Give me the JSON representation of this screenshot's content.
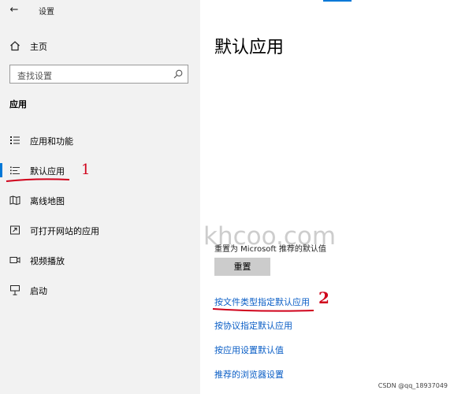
{
  "window": {
    "title": "设置",
    "back_icon": "arrow-left-icon"
  },
  "sidebar": {
    "home_label": "主页",
    "search_placeholder": "查找设置",
    "section_label": "应用",
    "items": [
      {
        "label": "应用和功能",
        "icon": "apps-list-icon"
      },
      {
        "label": "默认应用",
        "icon": "default-apps-icon",
        "selected": true
      },
      {
        "label": "离线地图",
        "icon": "map-icon"
      },
      {
        "label": "可打开网站的应用",
        "icon": "external-link-icon"
      },
      {
        "label": "视频播放",
        "icon": "video-icon"
      },
      {
        "label": "启动",
        "icon": "startup-icon"
      }
    ]
  },
  "main": {
    "title": "默认应用",
    "reset_text": "重置为 Microsoft 推荐的默认值",
    "reset_button": "重置",
    "links": [
      "按文件类型指定默认应用",
      "按协议指定默认应用",
      "按应用设置默认值",
      "推荐的浏览器设置"
    ]
  },
  "annotations": [
    "1",
    "2"
  ],
  "overlay": {
    "watermark": "khcoo.com",
    "credit": "CSDN @qq_18937049"
  },
  "colors": {
    "accent": "#0078d7",
    "link": "#0a5ec6",
    "annotation": "#d0021b",
    "sidebar_bg": "#f2f2f2"
  }
}
